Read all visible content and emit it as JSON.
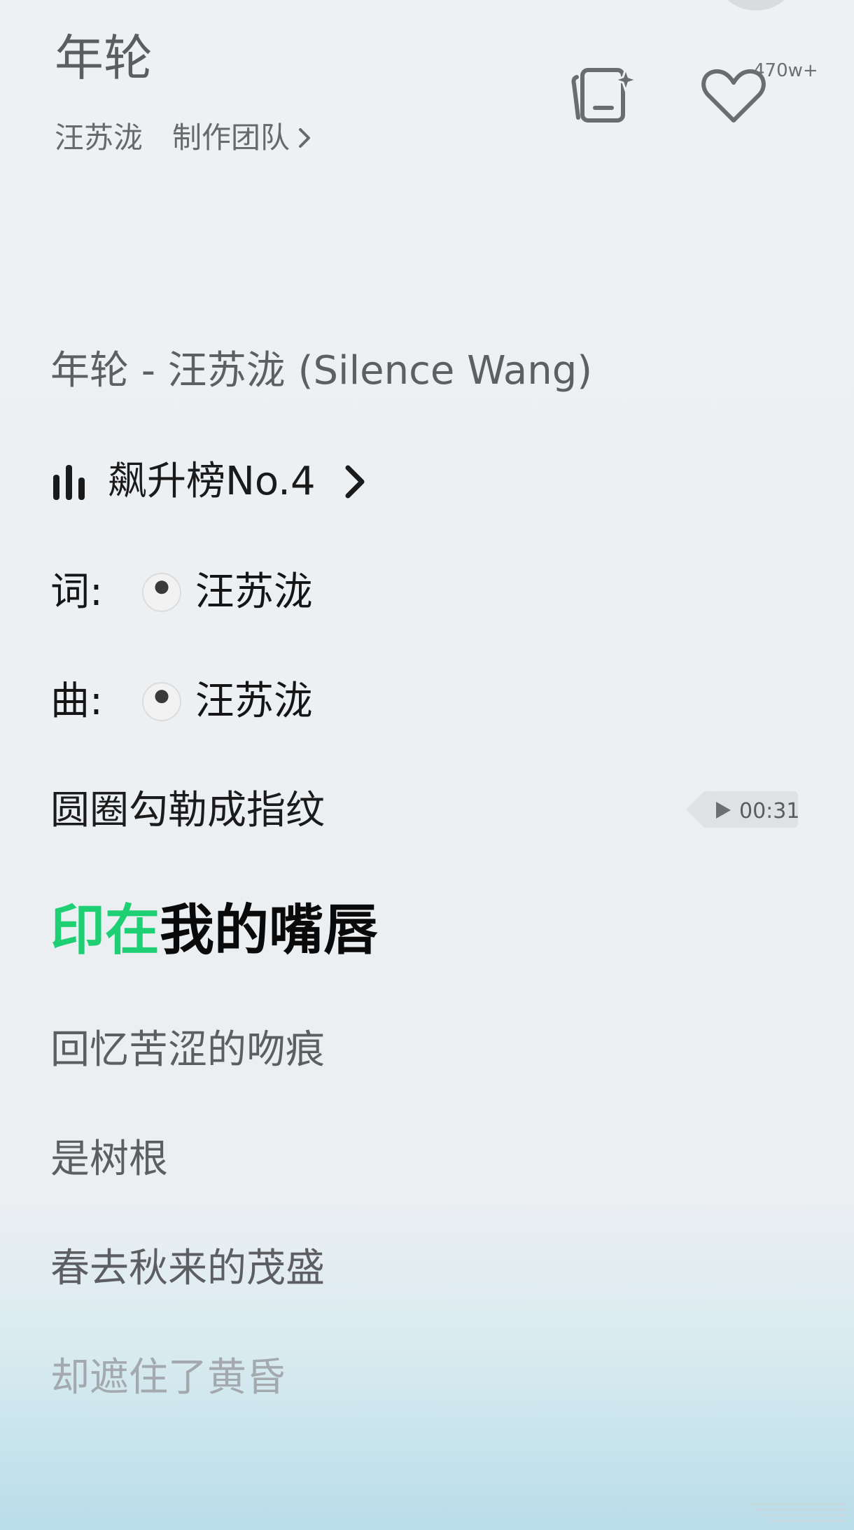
{
  "header": {
    "title": "年轮",
    "artist": "汪苏泷",
    "team_label": "制作团队",
    "like_count": "470w+"
  },
  "info": {
    "title_line": "年轮 - 汪苏泷 (Silence Wang)",
    "chart_rank": "飙升榜No.4",
    "lyricist_label": "词:",
    "lyricist_name": "汪苏泷",
    "composer_label": "曲:",
    "composer_name": "汪苏泷"
  },
  "lyrics": {
    "line1": "圆圈勾勒成指纹",
    "current_sung": "印在",
    "current_rest": "我的嘴唇",
    "line3": "回忆苦涩的吻痕",
    "line4": "是树根",
    "line5": "春去秋来的茂盛",
    "line6": "却遮住了黄昏"
  },
  "time_tag": "00:31",
  "colors": {
    "accent_green": "#1fcf73",
    "text_gray": "#5d5f62",
    "faded": "#a3a9ae"
  },
  "icons": [
    "add-to-playlist-icon",
    "heart-icon",
    "chevron-right-icon",
    "chart-bars-icon",
    "play-icon"
  ]
}
